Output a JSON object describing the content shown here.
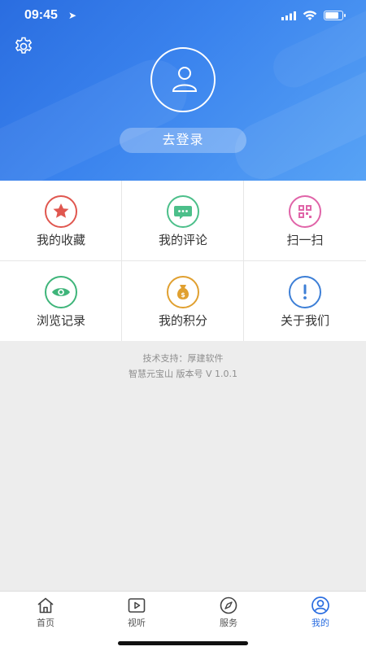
{
  "status_bar": {
    "time": "09:45"
  },
  "header": {
    "login_label": "去登录"
  },
  "menu": [
    {
      "label": "我的收藏",
      "icon": "star-icon",
      "color": "#e0574f"
    },
    {
      "label": "我的评论",
      "icon": "comment-icon",
      "color": "#4cbf8a"
    },
    {
      "label": "扫一扫",
      "icon": "qrcode-icon",
      "color": "#e064a8"
    },
    {
      "label": "浏览记录",
      "icon": "eye-icon",
      "color": "#3fb57a"
    },
    {
      "label": "我的积分",
      "icon": "money-bag-icon",
      "color": "#e0a030"
    },
    {
      "label": "关于我们",
      "icon": "info-icon",
      "color": "#3d7fd6"
    }
  ],
  "footer": {
    "support": "技术支持：厚建软件",
    "version": "智慧元宝山 版本号 V 1.0.1"
  },
  "tabs": [
    {
      "label": "首页",
      "icon": "home-icon"
    },
    {
      "label": "视听",
      "icon": "video-icon"
    },
    {
      "label": "服务",
      "icon": "compass-icon"
    },
    {
      "label": "我的",
      "icon": "user-icon",
      "active": true
    }
  ],
  "colors": {
    "accent": "#2a6de0",
    "background": "#ededed"
  }
}
